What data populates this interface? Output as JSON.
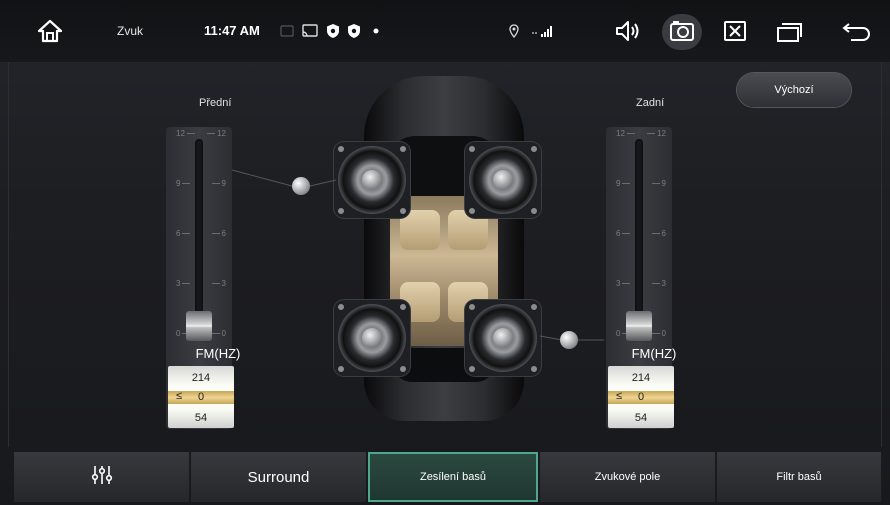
{
  "status_bar": {
    "title": "Zvuk",
    "time": "11:47 AM",
    "icons": [
      "home-icon",
      "cast-icon",
      "shield-icon",
      "shield-icon",
      "dot-icon",
      "location-icon",
      "signal-icon",
      "volume-icon",
      "screenshot-icon",
      "close-app-icon",
      "recent-apps-icon",
      "back-icon"
    ]
  },
  "front": {
    "label": "Přední",
    "ticks": [
      "12",
      "9",
      "6",
      "3",
      "0"
    ],
    "fm_label": "FM(HZ)",
    "readout": {
      "top": "214",
      "mid": "0",
      "bottom": "54",
      "sym": "≤"
    },
    "level": 0
  },
  "rear": {
    "label": "Zadní",
    "ticks": [
      "12",
      "9",
      "6",
      "3",
      "0"
    ],
    "fm_label": "FM(HZ)",
    "readout": {
      "top": "214",
      "mid": "0",
      "bottom": "54",
      "sym": "≤"
    },
    "level": 0
  },
  "default_button": "Výchozí",
  "tabs": [
    {
      "label": "",
      "icon": "equalizer-icon"
    },
    {
      "label": "Surround"
    },
    {
      "label": "Zesílení basů",
      "active": true
    },
    {
      "label": "Zvukové pole"
    },
    {
      "label": "Filtr basů"
    }
  ],
  "colors": {
    "accent": "#4fa889",
    "readout_band": "#efd492",
    "background": "#1d1e22"
  }
}
